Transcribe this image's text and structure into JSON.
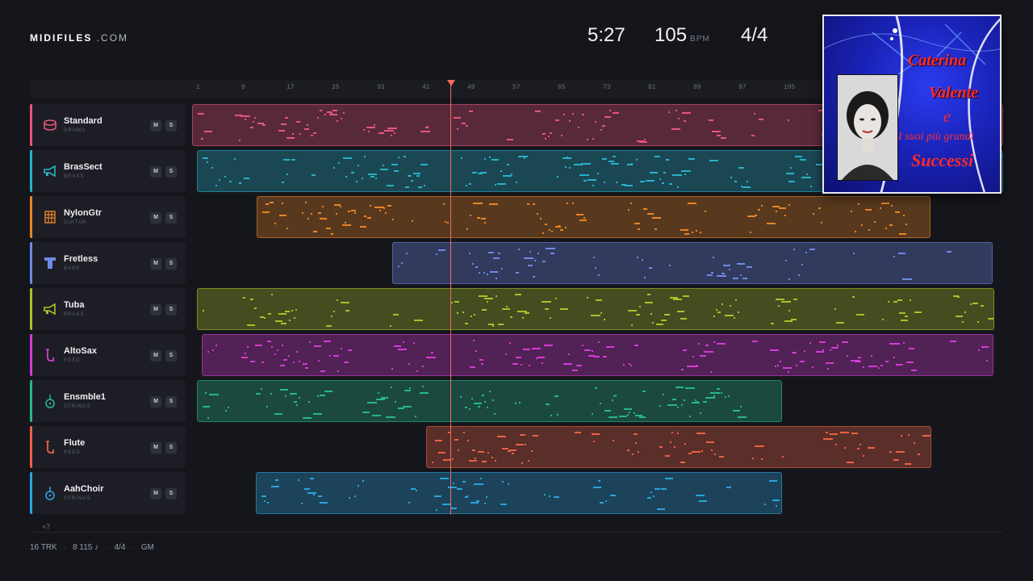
{
  "header": {
    "logo_main": "MIDIFILES",
    "logo_domain": ".COM",
    "time": "5:27",
    "tempo": "105",
    "tempo_unit": "BPM",
    "time_signature": "4/4"
  },
  "ruler": {
    "ticks": [
      "1",
      "9",
      "17",
      "25",
      "33",
      "41",
      "49",
      "57",
      "65",
      "73",
      "81",
      "89",
      "97",
      "105"
    ]
  },
  "tracks": [
    {
      "name": "Standard",
      "category": "DRUMS",
      "color": "#e6557d",
      "icon": "drum-icon",
      "mute": "M",
      "solo": "S"
    },
    {
      "name": "BrasSect",
      "category": "BRASS",
      "color": "#27b1c9",
      "icon": "trumpet-icon",
      "mute": "M",
      "solo": "S"
    },
    {
      "name": "NylonGtr",
      "category": "GUITAR",
      "color": "#ea8526",
      "icon": "guitar-fretboard-icon",
      "mute": "M",
      "solo": "S"
    },
    {
      "name": "Fretless",
      "category": "BASS",
      "color": "#6f89e8",
      "icon": "bass-icon",
      "mute": "M",
      "solo": "S"
    },
    {
      "name": "Tuba",
      "category": "BRASS",
      "color": "#a8c22a",
      "icon": "trumpet-icon",
      "mute": "M",
      "solo": "S"
    },
    {
      "name": "AltoSax",
      "category": "REED",
      "color": "#d43cd4",
      "icon": "saxophone-icon",
      "mute": "M",
      "solo": "S"
    },
    {
      "name": "Ensmble1",
      "category": "STRINGS",
      "color": "#27b68c",
      "icon": "violin-icon",
      "mute": "M",
      "solo": "S"
    },
    {
      "name": "Flute",
      "category": "REED",
      "color": "#ec6246",
      "icon": "saxophone-icon",
      "mute": "M",
      "solo": "S"
    },
    {
      "name": "AahChoir",
      "category": "STRINGS",
      "color": "#2ba4de",
      "icon": "violin-icon",
      "mute": "M",
      "solo": "S"
    }
  ],
  "more_tracks": "+7",
  "footer": {
    "tracks": "16 TRK",
    "notes": "8 115 ♪",
    "time_signature": "4/4",
    "standard": "GM"
  },
  "cover": {
    "line1": "Caterina",
    "line2": "Valente",
    "line3": "e",
    "line4": "I suoi più grandi",
    "line5": "Successi"
  }
}
